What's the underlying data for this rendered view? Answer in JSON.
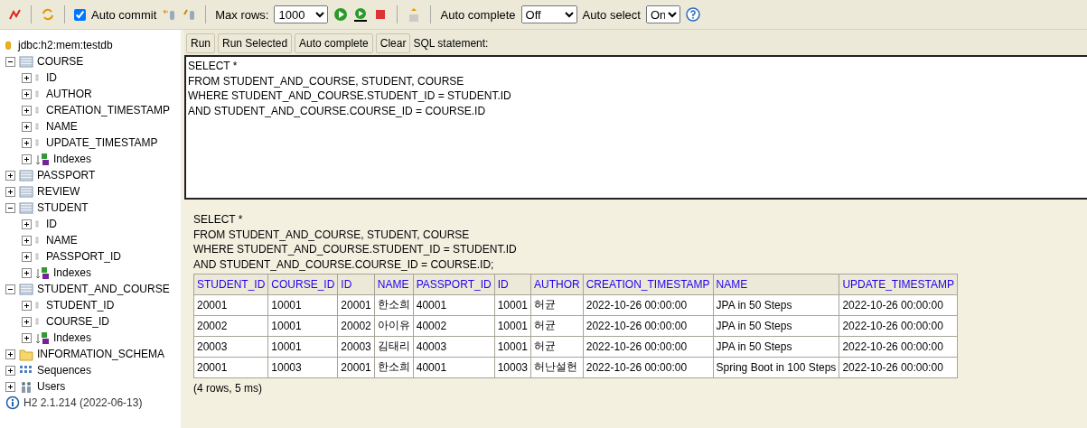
{
  "toolbar": {
    "auto_commit": {
      "label": "Auto commit",
      "checked": true
    },
    "max_rows": {
      "label": "Max rows:",
      "value": "1000"
    },
    "auto_complete": {
      "label": "Auto complete",
      "value": "Off"
    },
    "auto_select": {
      "label": "Auto select",
      "value": "On"
    }
  },
  "tree": [
    {
      "kind": "database",
      "label": "jdbc:h2:mem:testdb"
    },
    {
      "kind": "table",
      "label": "COURSE",
      "expanded": true,
      "children": [
        {
          "kind": "column",
          "label": "ID",
          "expanded": false
        },
        {
          "kind": "column",
          "label": "AUTHOR",
          "expanded": false
        },
        {
          "kind": "column",
          "label": "CREATION_TIMESTAMP",
          "expanded": false
        },
        {
          "kind": "column",
          "label": "NAME",
          "expanded": false
        },
        {
          "kind": "column",
          "label": "UPDATE_TIMESTAMP",
          "expanded": false
        },
        {
          "kind": "indexes",
          "label": "Indexes",
          "expanded": false
        }
      ]
    },
    {
      "kind": "table",
      "label": "PASSPORT",
      "expanded": false
    },
    {
      "kind": "table",
      "label": "REVIEW",
      "expanded": false
    },
    {
      "kind": "table",
      "label": "STUDENT",
      "expanded": true,
      "children": [
        {
          "kind": "column",
          "label": "ID",
          "expanded": false
        },
        {
          "kind": "column",
          "label": "NAME",
          "expanded": false
        },
        {
          "kind": "column",
          "label": "PASSPORT_ID",
          "expanded": false
        },
        {
          "kind": "indexes",
          "label": "Indexes",
          "expanded": false
        }
      ]
    },
    {
      "kind": "table",
      "label": "STUDENT_AND_COURSE",
      "expanded": true,
      "children": [
        {
          "kind": "column",
          "label": "STUDENT_ID",
          "expanded": false
        },
        {
          "kind": "column",
          "label": "COURSE_ID",
          "expanded": false
        },
        {
          "kind": "indexes",
          "label": "Indexes",
          "expanded": false
        }
      ]
    },
    {
      "kind": "folder",
      "label": "INFORMATION_SCHEMA",
      "expanded": false
    },
    {
      "kind": "sequences",
      "label": "Sequences",
      "expanded": false
    },
    {
      "kind": "users",
      "label": "Users",
      "expanded": false
    },
    {
      "kind": "info",
      "label": "H2 2.1.214 (2022-06-13)"
    }
  ],
  "buttons": [
    "Run",
    "Run Selected",
    "Auto complete",
    "Clear"
  ],
  "sql_label": "SQL statement:",
  "sql_editor": {
    "value": "SELECT *\nFROM STUDENT_AND_COURSE, STUDENT, COURSE\nWHERE STUDENT_AND_COURSE.STUDENT_ID = STUDENT.ID\nAND STUDENT_AND_COURSE.COURSE_ID = COURSE.ID"
  },
  "result": {
    "query": [
      "SELECT *",
      "FROM STUDENT_AND_COURSE, STUDENT, COURSE",
      "WHERE STUDENT_AND_COURSE.STUDENT_ID = STUDENT.ID",
      "AND STUDENT_AND_COURSE.COURSE_ID = COURSE.ID;"
    ],
    "columns": [
      "STUDENT_ID",
      "COURSE_ID",
      "ID",
      "NAME",
      "PASSPORT_ID",
      "ID",
      "AUTHOR",
      "CREATION_TIMESTAMP",
      "NAME",
      "UPDATE_TIMESTAMP"
    ],
    "rows": [
      [
        "20001",
        "10001",
        "20001",
        "한소희",
        "40001",
        "10001",
        "허균",
        "2022-10-26 00:00:00",
        "JPA in 50 Steps",
        "2022-10-26 00:00:00"
      ],
      [
        "20002",
        "10001",
        "20002",
        "아이유",
        "40002",
        "10001",
        "허균",
        "2022-10-26 00:00:00",
        "JPA in 50 Steps",
        "2022-10-26 00:00:00"
      ],
      [
        "20003",
        "10001",
        "20003",
        "김태리",
        "40003",
        "10001",
        "허균",
        "2022-10-26 00:00:00",
        "JPA in 50 Steps",
        "2022-10-26 00:00:00"
      ],
      [
        "20001",
        "10003",
        "20001",
        "한소희",
        "40001",
        "10003",
        "허난설헌",
        "2022-10-26 00:00:00",
        "Spring Boot in 100 Steps",
        "2022-10-26 00:00:00"
      ]
    ],
    "summary": "(4 rows, 5 ms)"
  }
}
